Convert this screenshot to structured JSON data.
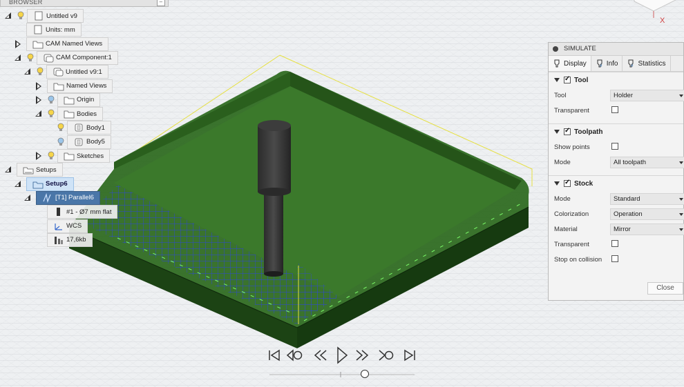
{
  "browser": {
    "header": "BROWSER",
    "items": [
      {
        "label": "Untitled v9",
        "depth": 0,
        "expander": "open",
        "bulb": "on",
        "icon": "doc"
      },
      {
        "label": "Units: mm",
        "depth": 1,
        "expander": "none",
        "bulb": "none",
        "icon": "doc"
      },
      {
        "label": "CAM Named Views",
        "depth": 1,
        "expander": "closed",
        "bulb": "none",
        "icon": "folder"
      },
      {
        "label": "CAM Component:1",
        "depth": 1,
        "expander": "open",
        "bulb": "on",
        "icon": "component"
      },
      {
        "label": "Untitled v9:1",
        "depth": 2,
        "expander": "open",
        "bulb": "on",
        "icon": "component"
      },
      {
        "label": "Named Views",
        "depth": 3,
        "expander": "closed",
        "bulb": "none",
        "icon": "folder"
      },
      {
        "label": "Origin",
        "depth": 3,
        "expander": "closed",
        "bulb": "off",
        "icon": "folder"
      },
      {
        "label": "Bodies",
        "depth": 3,
        "expander": "open",
        "bulb": "on",
        "icon": "folder"
      },
      {
        "label": "Body1",
        "depth": 4,
        "expander": "none",
        "bulb": "on",
        "icon": "body"
      },
      {
        "label": "Body5",
        "depth": 4,
        "expander": "none",
        "bulb": "off",
        "icon": "body"
      },
      {
        "label": "Sketches",
        "depth": 3,
        "expander": "closed",
        "bulb": "on",
        "icon": "folder"
      },
      {
        "label": "Setups",
        "depth": 0,
        "expander": "open",
        "bulb": "none",
        "icon": "setups"
      },
      {
        "label": "Setup6",
        "depth": 1,
        "expander": "open",
        "bulb": "none",
        "icon": "setup",
        "state": "selected"
      },
      {
        "label": "[T1] Parallel6",
        "depth": 2,
        "expander": "open",
        "bulb": "none",
        "icon": "op",
        "state": "active"
      },
      {
        "label": "#1 - Ø7 mm flat",
        "depth": 3,
        "expander": "none",
        "bulb": "none",
        "icon": "tool"
      },
      {
        "label": "WCS",
        "depth": 3,
        "expander": "none",
        "bulb": "none",
        "icon": "wcs"
      },
      {
        "label": "17,6kb",
        "depth": 3,
        "expander": "none",
        "bulb": "none",
        "icon": "nc"
      }
    ]
  },
  "simulate": {
    "title": "SIMULATE",
    "tabs": [
      {
        "label": "Display",
        "icon": "display-icon",
        "active": true
      },
      {
        "label": "Info",
        "icon": "info-icon",
        "active": false
      },
      {
        "label": "Statistics",
        "icon": "statistics-icon",
        "active": false
      }
    ],
    "tool": {
      "header": "Tool",
      "tool_label": "Tool",
      "tool_value": "Holder",
      "transparent_label": "Transparent",
      "transparent_checked": false
    },
    "toolpath": {
      "header": "Toolpath",
      "show_points_label": "Show points",
      "show_points_checked": false,
      "mode_label": "Mode",
      "mode_value": "All toolpath"
    },
    "stock": {
      "header": "Stock",
      "mode_label": "Mode",
      "mode_value": "Standard",
      "colorization_label": "Colorization",
      "colorization_value": "Operation",
      "material_label": "Material",
      "material_value": "Mirror",
      "transparent_label": "Transparent",
      "transparent_checked": false,
      "stop_label": "Stop on collision",
      "stop_checked": false
    },
    "close_label": "Close"
  },
  "viewcube": {
    "axis_label": "X"
  },
  "playback": {
    "buttons": [
      "skip-to-start",
      "step-back-operation",
      "step-back",
      "play",
      "step-forward",
      "step-forward-operation",
      "skip-to-end"
    ],
    "position": 0.65
  },
  "colors": {
    "stock_green": "#2f6b22",
    "stock_dark": "#1f4617",
    "toolpath_blue": "#1a2ccc",
    "accent_selected": "#4a76a8"
  }
}
